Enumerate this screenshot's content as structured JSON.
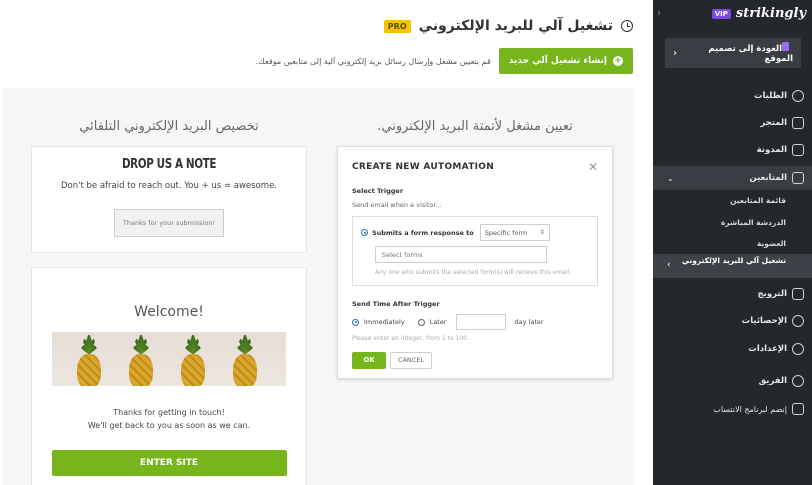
{
  "page": {
    "title": "تشغيل آلي للبريد الإلكتروني",
    "pro_badge": "PRO",
    "create_button": "إنشاء تشغيل آلي جديد",
    "description": "قم بتعيين مشغل وإرسال رسائل بريد إلكتروني آلية إلى متابعين موقعك."
  },
  "columns": {
    "left_title": "تخصيص البريد الإلكتروني التلقائي",
    "right_title": "تعيين مشغل لأتمتة البريد الإلكتروني."
  },
  "drop_card": {
    "title": "DROP US A NOTE",
    "subtitle": "Don't be afraid to reach out. You + us = awesome.",
    "button": "Thanks for your submission!"
  },
  "welcome_card": {
    "title": "Welcome!",
    "line1": "Thanks for getting in touch!",
    "line2": "We'll get back to you as soon as we can.",
    "button": "ENTER SITE"
  },
  "automation": {
    "title": "CREATE NEW AUTOMATION",
    "close_icon": "close-icon",
    "trigger_label": "Select Trigger",
    "trigger_sub": "Send email when a visitor...",
    "option_label": "Submits a form response to",
    "option_select": "Specific form",
    "forms_placeholder": "Select forms",
    "forms_hint": "Any one who submits the selected form(s) will receive this email.",
    "send_label": "Send Time After Trigger",
    "immediately": "Immediately",
    "later": "Later",
    "day_later": "day later",
    "range_hint": "Please enter an integer, from 1 to 100.",
    "ok": "OK",
    "cancel": "CANCEL"
  },
  "sidebar": {
    "vip": "VIP",
    "logo": "strikingly",
    "back": "العودة إلى تصميم الموقع",
    "items": [
      {
        "label": "الطلبات",
        "icon": "dollar-icon"
      },
      {
        "label": "المتجر",
        "icon": "store-icon"
      },
      {
        "label": "المدونة",
        "icon": "pen-icon"
      },
      {
        "label": "المتابعين",
        "icon": "users-icon"
      },
      {
        "label": "الترويج",
        "icon": "megaphone-icon"
      },
      {
        "label": "الإحصائيات",
        "icon": "pie-chart-icon"
      },
      {
        "label": "الإعدادات",
        "icon": "gear-icon"
      },
      {
        "label": "الفريق",
        "icon": "team-icon"
      },
      {
        "label": "إنضم لبرنامج الانتساب",
        "icon": "trophy-icon"
      }
    ],
    "subitems": [
      "قائمة المتابعين",
      "الدردشة المباشرة",
      "العضوية",
      "تشغيل آلي للبريد الإلكتروني"
    ]
  },
  "colors": {
    "accent": "#76b61c",
    "pro": "#f3c300",
    "vip": "#7b4ae2",
    "sidebar_bg": "#24272b"
  }
}
